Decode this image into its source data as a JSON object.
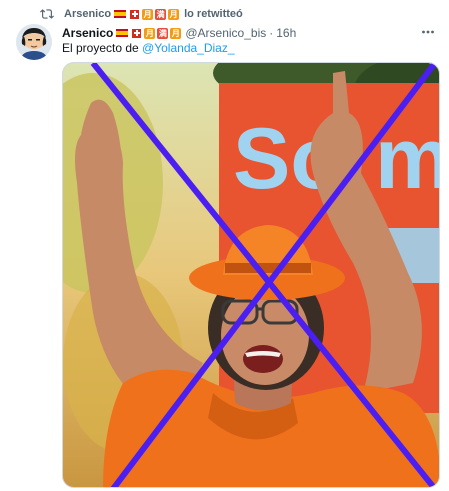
{
  "retweet": {
    "user": "Arsenico",
    "label": "lo retwitteó"
  },
  "tweet": {
    "name": "Arsenico",
    "handle": "@Arsenico_bis",
    "separator": "·",
    "time": "16h",
    "text_prefix": "El proyecto de ",
    "mention": "@Yolanda_Diaz_"
  },
  "badges": {
    "kanji_1": "月",
    "kanji_2": "満",
    "kanji_3": "月"
  },
  "media": {
    "sign_text": "So",
    "sign_text_2": "m",
    "overlay": "cross"
  },
  "colors": {
    "accent": "#1d9bf0",
    "cross": "#4b1ef2",
    "sign": "#e8542f",
    "shirt": "#f0711c"
  },
  "icons": {
    "retweet": "retweet-icon",
    "more": "more-icon"
  }
}
